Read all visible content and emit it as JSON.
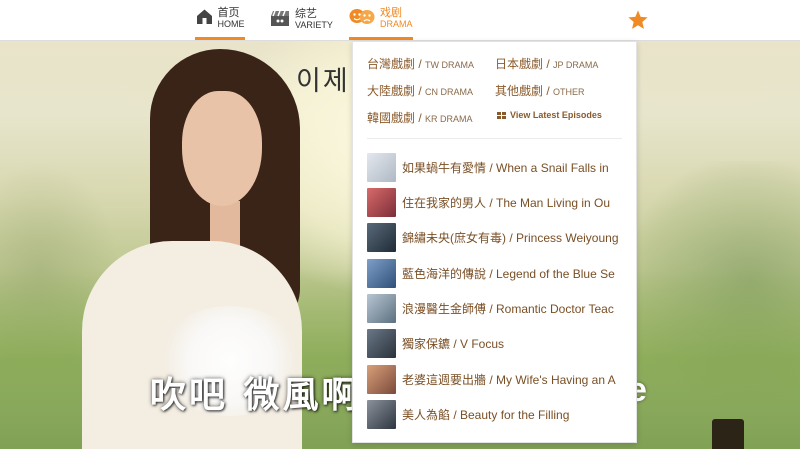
{
  "nav": {
    "home": {
      "zh": "首页",
      "en": "HOME"
    },
    "variety": {
      "zh": "综艺",
      "en": "VARIETY"
    },
    "drama": {
      "zh": "戏剧",
      "en": "DRAMA"
    },
    "accent_color": "#f08a24"
  },
  "hero": {
    "korean_caption": "이제                  처럼 그렇게",
    "subtitle_zh": "吹吧 微風啊",
    "subtitle_tail": "e"
  },
  "dropdown": {
    "categories": [
      {
        "zh": "台灣戲劇",
        "en": "TW DRAMA"
      },
      {
        "zh": "日本戲劇",
        "en": "JP DRAMA"
      },
      {
        "zh": "大陸戲劇",
        "en": "CN DRAMA"
      },
      {
        "zh": "其他戲劇",
        "en": "OTHER"
      },
      {
        "zh": "韓國戲劇",
        "en": "KR DRAMA"
      }
    ],
    "separator": "/",
    "latest_label": "View Latest Episodes",
    "episodes": [
      {
        "title": "如果蝸牛有愛情 / When a Snail Falls in",
        "thumb_color": "#c9d2dc"
      },
      {
        "title": "住在我家的男人 / The Man Living in Ou",
        "thumb_color": "#b04a4a"
      },
      {
        "title": "錦繡未央(庶女有毒) / Princess Weiyoung",
        "thumb_color": "#3b4a5a"
      },
      {
        "title": "藍色海洋的傳說 / Legend of the Blue Se",
        "thumb_color": "#5a7fa8"
      },
      {
        "title": "浪漫醫生金師傅 / Romantic Doctor Teac",
        "thumb_color": "#8aa0b4"
      },
      {
        "title": "獨家保鑣 / V Focus",
        "thumb_color": "#4a5a6a"
      },
      {
        "title": "老婆這週要出牆 / My Wife's Having an A",
        "thumb_color": "#b97a5a"
      },
      {
        "title": "美人為餡 / Beauty for the Filling",
        "thumb_color": "#5a6470"
      }
    ]
  }
}
